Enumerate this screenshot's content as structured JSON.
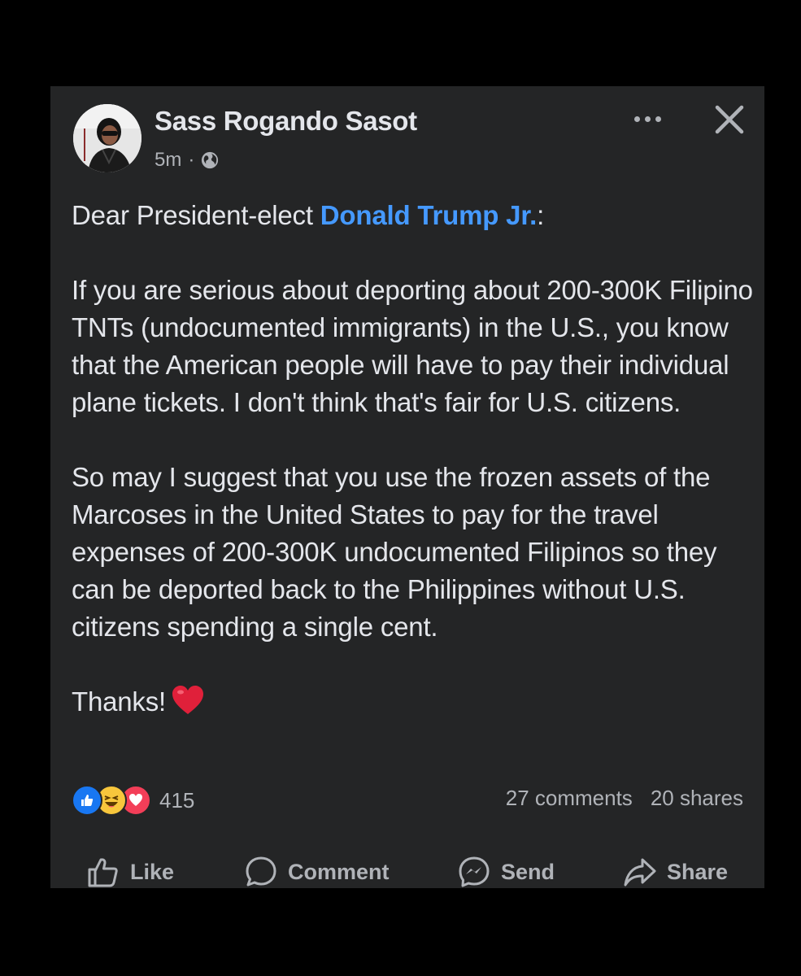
{
  "post": {
    "author": "Sass Rogando Sasot",
    "time": "5m",
    "separator": "·",
    "visibility_icon": "globe-icon",
    "body": {
      "greeting_prefix": "Dear President-elect ",
      "mention": "Donald Trump Jr.",
      "greeting_suffix": ":",
      "paragraph_1": "If you are serious about deporting about 200-300K Filipino TNTs (undocumented immigrants) in the U.S., you know that the American people will have to pay their individual plane tickets. I don't think that's fair for U.S. citizens.",
      "paragraph_2": "So may I suggest that you use the frozen assets of the Marcoses in the United States to pay for the travel expenses of 200-300K undocumented Filipinos so they can be deported back to the Philippines without U.S. citizens spending a single cent.",
      "sign_off": "Thanks!"
    },
    "reactions": {
      "icons": [
        "like-icon",
        "haha-icon",
        "love-icon"
      ],
      "count": "415"
    },
    "comments": "27 comments",
    "shares": "20 shares"
  },
  "actions": {
    "like": "Like",
    "comment": "Comment",
    "send": "Send",
    "share": "Share"
  },
  "colors": {
    "background": "#000000",
    "card": "#242526",
    "text": "#e4e6eb",
    "secondary_text": "#b0b3b8",
    "mention": "#4599ff",
    "heart": "#e0203a",
    "like_blue": "#1877f2",
    "haha_yellow": "#f7c63c",
    "love_red": "#f33e58"
  }
}
